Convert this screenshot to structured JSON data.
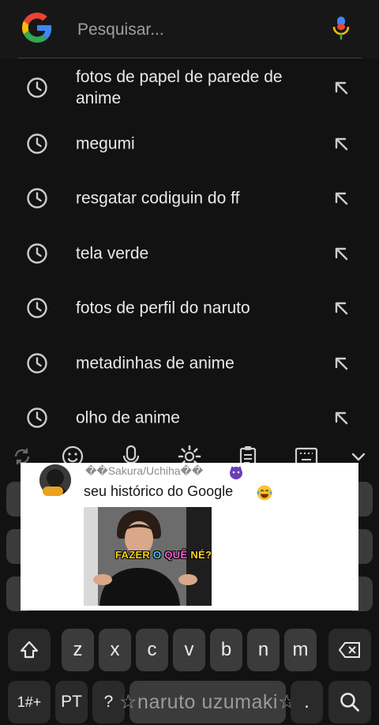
{
  "search": {
    "placeholder": "Pesquisar..."
  },
  "suggestions": [
    {
      "text": "fotos de papel de parede de anime"
    },
    {
      "text": "megumi"
    },
    {
      "text": "resgatar codiguin do ff"
    },
    {
      "text": "tela verde"
    },
    {
      "text": "fotos de perfil do naruto"
    },
    {
      "text": "metadinhas de anime"
    },
    {
      "text": "olho de anime"
    }
  ],
  "keyboard": {
    "toolbar": [
      "sync-icon",
      "emoji-icon",
      "mic-icon",
      "settings-icon",
      "clipboard-icon",
      "keyboard-layout-icon",
      "collapse-icon"
    ],
    "row_bottom_letters": [
      "z",
      "x",
      "c",
      "v",
      "b",
      "n",
      "m"
    ],
    "symbols_label": "1#+",
    "language_label": "PT",
    "question_label": "?",
    "space_label": "☆naruto uzumaki☆",
    "period_label": "."
  },
  "comment": {
    "username": "��Sakura/Uchiha��",
    "text": "seu histórico do Google",
    "meme": {
      "caption_parts": [
        {
          "text": "FAZER ",
          "color": "#f5d40f"
        },
        {
          "text": "O ",
          "color": "#4fc3ff"
        },
        {
          "text": "QUÊ ",
          "color": "#ff5ad1"
        },
        {
          "text": "NÉ?",
          "color": "#ffd21f"
        }
      ]
    }
  },
  "colors": {
    "background": "#121212",
    "text": "#e8eaed",
    "placeholder": "#9aa0a6",
    "key": "#3b3b3b",
    "card": "#ffffff"
  }
}
